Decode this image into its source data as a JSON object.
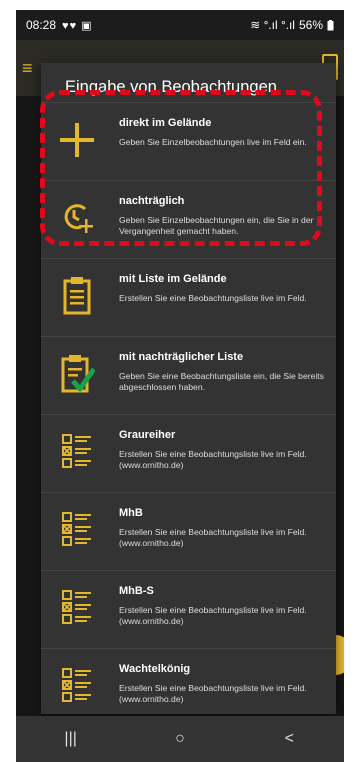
{
  "status": {
    "time": "08:28",
    "left_icons": "♥♥ ▣",
    "network": "≋ ᐤ.ıl ᐤ.ıl",
    "battery": "56%"
  },
  "dialog": {
    "title": "Eingabe von Beobachtungen",
    "items": [
      {
        "title": "direkt im Gelände",
        "desc": "Geben Sie Einzelbeobachtungen live im Feld ein.",
        "icon": "plus-icon"
      },
      {
        "title": "nachträglich",
        "desc": "Geben Sie Einzelbeobachtungen ein, die Sie in der Vergangenheit gemacht haben.",
        "icon": "clock-plus-icon"
      },
      {
        "title": "mit Liste im Gelände",
        "desc": "Erstellen Sie eine Beobachtungsliste live im Feld.",
        "icon": "clipboard-icon"
      },
      {
        "title": "mit nachträglicher Liste",
        "desc": "Geben Sie eine Beobachtungsliste ein, die Sie bereits abgeschlossen haben.",
        "icon": "clipboard-check-icon"
      },
      {
        "title": "Graureiher",
        "desc": "Erstellen Sie eine Beobachtungsliste live im Feld. (www.ornitho.de)",
        "icon": "checklist-icon"
      },
      {
        "title": "MhB",
        "desc": "Erstellen Sie eine Beobachtungsliste live im Feld. (www.ornitho.de)",
        "icon": "checklist-icon"
      },
      {
        "title": "MhB-S",
        "desc": "Erstellen Sie eine Beobachtungsliste live im Feld. (www.ornitho.de)",
        "icon": "checklist-icon"
      },
      {
        "title": "Wachtelkönig",
        "desc": "Erstellen Sie eine Beobachtungsliste live im Feld. (www.ornitho.de)",
        "icon": "checklist-icon"
      }
    ]
  },
  "navbar": {
    "recent": "|||",
    "home": "○",
    "back": "<"
  },
  "colors": {
    "accent": "#e4b62c",
    "highlight": "#e0081b",
    "dialog_bg": "#333333",
    "check_green": "#1aa24a"
  }
}
